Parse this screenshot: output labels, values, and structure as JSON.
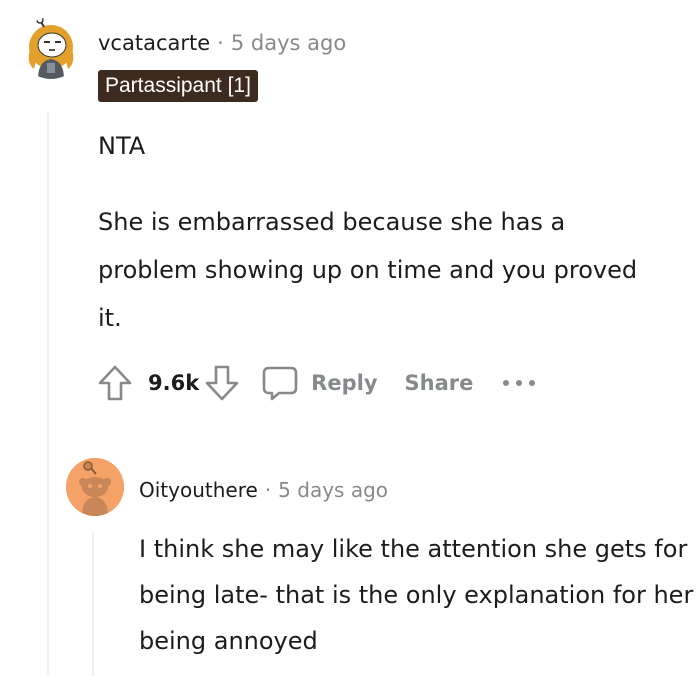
{
  "comment": {
    "author": "vcatacarte",
    "separator": "·",
    "time": "5 days ago",
    "flair": "Partassipant [1]",
    "body_line1": "NTA",
    "body_line2": "She is embarrassed because she has a problem showing up on time and you proved it.",
    "actions": {
      "upvote_icon": "arrow-up-icon",
      "score": "9.6k",
      "downvote_icon": "arrow-down-icon",
      "reply_icon": "speech-bubble-icon",
      "reply_label": "Reply",
      "share_label": "Share",
      "more_icon": "ellipsis-icon"
    }
  },
  "reply": {
    "author": "Oityouthere",
    "separator": "·",
    "time": "5 days ago",
    "body": "I think she may like the attention she gets for being late- that is the only explanation for her being annoyed"
  },
  "colors": {
    "text": "#1c1c1c",
    "muted": "#878a8c",
    "flair_bg": "#3d2b1f",
    "thread_line": "#edeff1",
    "reply_avatar_bg": "#f5a268"
  }
}
